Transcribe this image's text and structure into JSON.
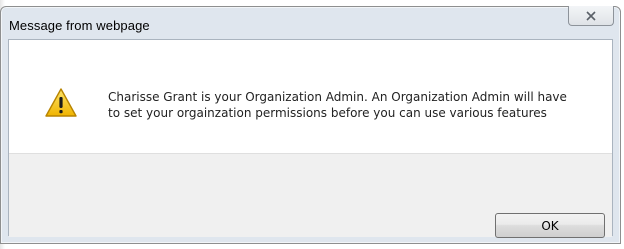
{
  "dialog": {
    "title": "Message from webpage",
    "close_label": "",
    "message": "Charisse Grant is your Organization Admin.  An Organization Admin will have to set your orgainzation permissions before you can use various features",
    "ok_label": "OK",
    "icon": "warning-icon"
  },
  "colors": {
    "frame": "#dfe6ee",
    "footer": "#f0f0f0",
    "warning_fill": "#f5c400"
  }
}
